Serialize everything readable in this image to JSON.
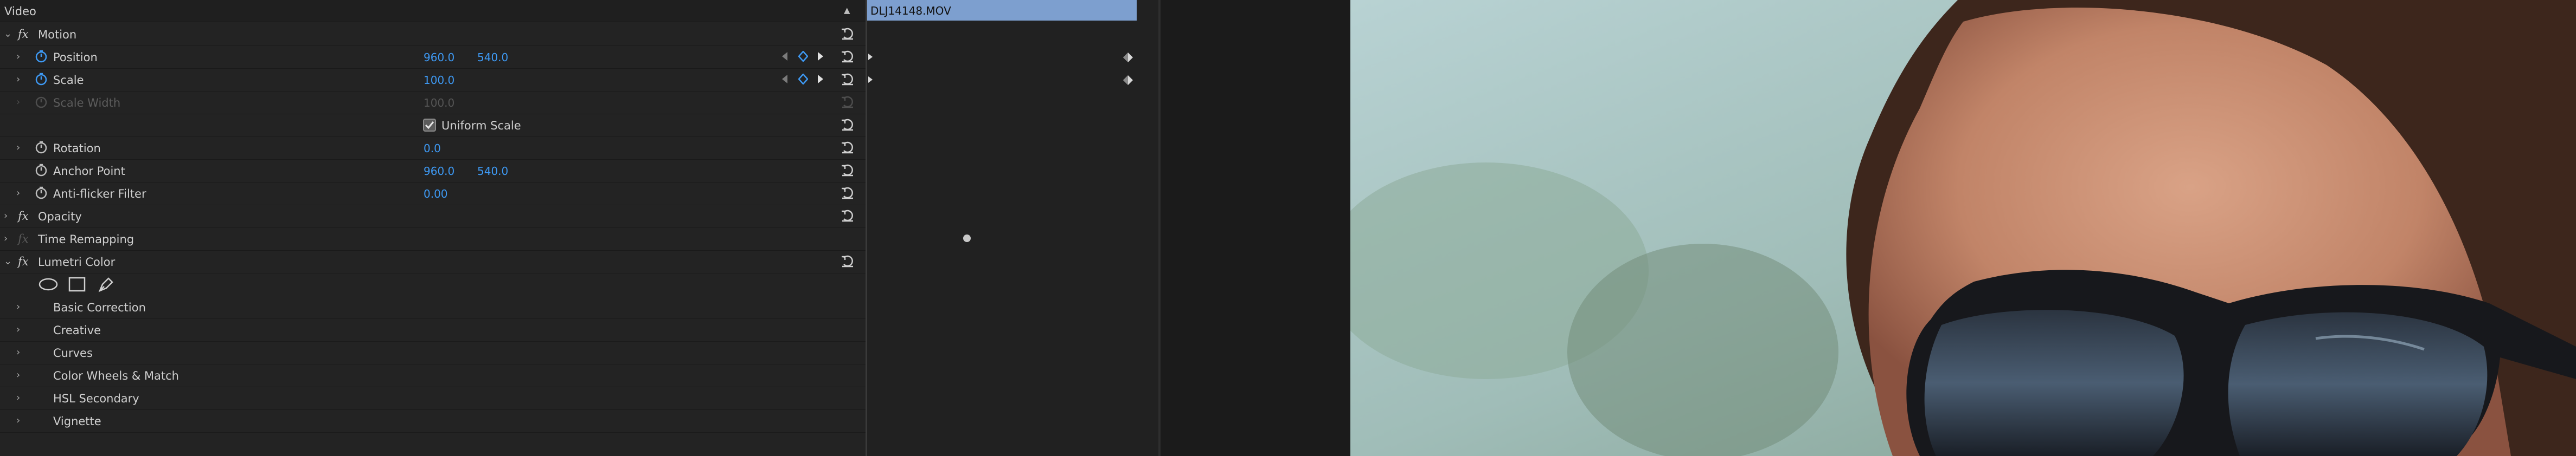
{
  "effect_controls": {
    "header_title": "Video",
    "sections": [
      {
        "fx": "fx",
        "label": "Motion"
      },
      {
        "label": "Position",
        "value1": "960.0",
        "value2": "540.0"
      },
      {
        "label": "Scale",
        "value1": "100.0"
      },
      {
        "label": "Scale Width",
        "value1": "100.0"
      },
      {
        "checkbox_label": "Uniform Scale",
        "checked": true
      },
      {
        "label": "Rotation",
        "value1": "0.0"
      },
      {
        "label": "Anchor Point",
        "value1": "960.0",
        "value2": "540.0"
      },
      {
        "label": "Anti-flicker Filter",
        "value1": "0.00"
      },
      {
        "fx": "fx",
        "label": "Opacity"
      },
      {
        "fx": "fx",
        "label": "Time Remapping"
      },
      {
        "fx": "fx",
        "label": "Lumetri Color"
      },
      {
        "label": "Basic Correction"
      },
      {
        "label": "Creative"
      },
      {
        "label": "Curves"
      },
      {
        "label": "Color Wheels & Match"
      },
      {
        "label": "HSL Secondary"
      },
      {
        "label": "Vignette"
      }
    ]
  },
  "timeline": {
    "clip_name": "DLJ14148.MOV"
  },
  "colors": {
    "value_blue": "#3e9af5",
    "clip_bar": "#7d9fcf",
    "panel_bg": "#232323"
  }
}
